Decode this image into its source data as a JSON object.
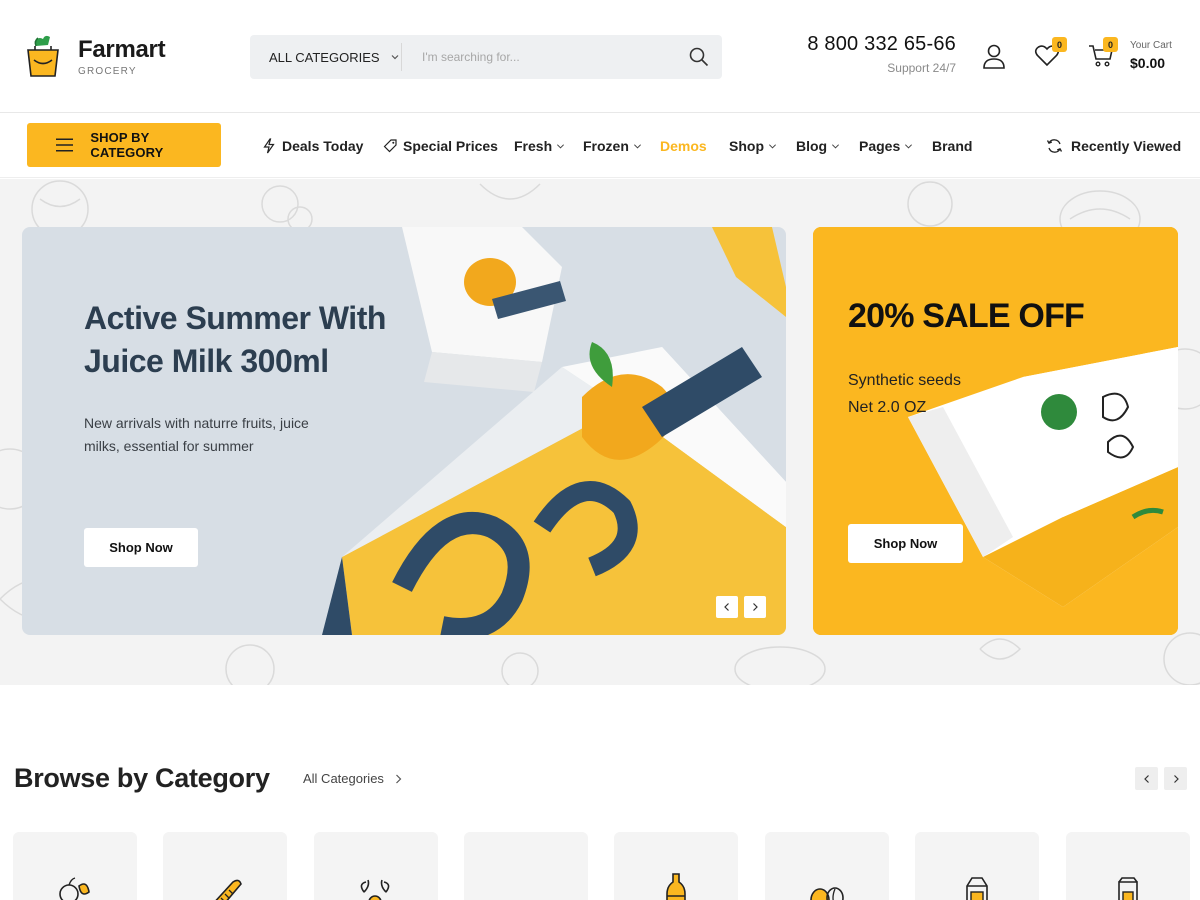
{
  "brand": {
    "name": "Farmart",
    "tagline": "GROCERY"
  },
  "search": {
    "category_label": "ALL CATEGORIES",
    "placeholder": "I'm searching for..."
  },
  "support": {
    "phone": "8 800 332 65-66",
    "label": "Support 24/7"
  },
  "header_icons": {
    "account": "user-icon",
    "wishlist": "heart-icon",
    "cart": "cart-icon"
  },
  "wishlist": {
    "count": "0"
  },
  "cart": {
    "count": "0",
    "label": "Your Cart",
    "total": "$0.00"
  },
  "nav": {
    "shop_by_category": "SHOP BY CATEGORY",
    "items": [
      {
        "label": "Deals Today",
        "icon": "lightning-icon"
      },
      {
        "label": "Special Prices",
        "icon": "tag-icon"
      },
      {
        "label": "Fresh",
        "dropdown": true
      },
      {
        "label": "Frozen",
        "dropdown": true
      },
      {
        "label": "Demos",
        "active": true
      },
      {
        "label": "Shop",
        "dropdown": true
      },
      {
        "label": "Blog",
        "dropdown": true
      },
      {
        "label": "Pages",
        "dropdown": true
      },
      {
        "label": "Brand"
      }
    ],
    "recently_viewed": "Recently Viewed"
  },
  "hero": {
    "main": {
      "title_line1": "Active Summer With",
      "title_line2": "Juice Milk 300ml",
      "desc_line1": "New arrivals with naturre fruits, juice",
      "desc_line2": "milks, essential for summer",
      "button": "Shop Now"
    },
    "side": {
      "title": "20% SALE OFF",
      "desc_line1": "Synthetic seeds",
      "desc_line2": "Net 2.0 OZ",
      "button": "Shop Now"
    }
  },
  "browse": {
    "title": "Browse by Category",
    "all_link": "All Categories",
    "category_icons": [
      "fruits-icon",
      "bakery-icon",
      "seafood-icon",
      "breakfast-icon",
      "drinks-icon",
      "coffee-icon",
      "milk-icon",
      "bag-icon"
    ]
  },
  "colors": {
    "accent": "#fbb720",
    "hero_bg": "#f3f3f3",
    "main_banner": "#d7dee5",
    "heading": "#2c3e50"
  }
}
